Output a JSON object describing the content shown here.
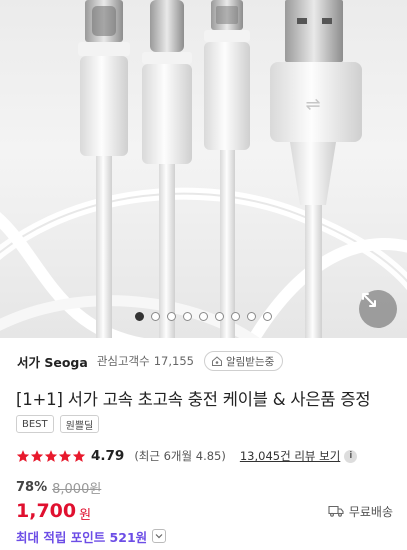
{
  "gallery": {
    "slide_count": 9,
    "active_index": 0,
    "expand_icon": "expand-arrows-icon"
  },
  "seller": {
    "name": "서가 Seoga",
    "followers_label": "관심고객수",
    "followers_count": "17,155",
    "alarm_label": "알림받는중",
    "alarm_icon": "home-bell-icon"
  },
  "product": {
    "title": "[1+1] 서가 고속 초고속 충전 케이블 & 사은품 증정",
    "badges": [
      "BEST",
      "원쁠딜"
    ]
  },
  "rating": {
    "value": "4.79",
    "stars": 5,
    "recent": "(최근 6개월 4.85)",
    "review_link": "13,045건 리뷰 보기"
  },
  "pricing": {
    "discount": "78%",
    "original_price": "8,000원",
    "price": "1,700",
    "currency": "원",
    "shipping": "무료배송",
    "points": "최대 적립 포인트 521원"
  },
  "colors": {
    "price_red": "#e0102f",
    "points_purple": "#6c4de6",
    "star_red": "#e8192c"
  }
}
